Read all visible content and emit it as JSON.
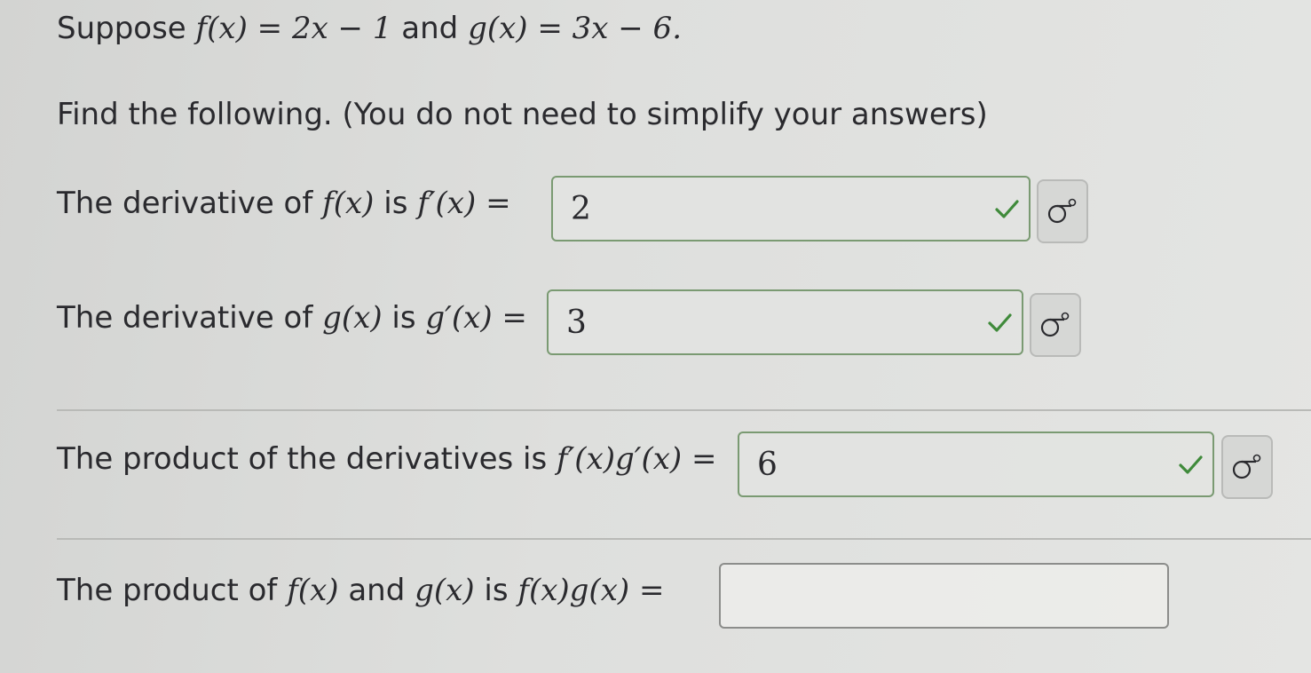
{
  "problem": {
    "intro_text": "Suppose",
    "f_def": "f(x) = 2x − 1",
    "and_text": "and",
    "g_def": "g(x) = 3x − 6.",
    "instructions": "Find the following. (You do not need to simplify your answers)"
  },
  "rows": [
    {
      "label_prefix": "The derivative of",
      "func": "f(x)",
      "is": "is",
      "expr": "f′(x)",
      "equals": "=",
      "answer": "2",
      "status": "correct"
    },
    {
      "label_prefix": "The derivative of",
      "func": "g(x)",
      "is": "is",
      "expr": "g′(x)",
      "equals": "=",
      "answer": "3",
      "status": "correct"
    },
    {
      "label_prefix": "The product of the derivatives is",
      "expr": "f′(x)g′(x)",
      "equals": "=",
      "answer": "6",
      "status": "correct"
    },
    {
      "label_prefix": "The product of",
      "func": "f(x)",
      "and": "and",
      "func2": "g(x)",
      "is": "is",
      "expr": "f(x)g(x)",
      "equals": "=",
      "answer": "",
      "status": "unanswered"
    }
  ],
  "colors": {
    "correct_border": "#7a9a72",
    "check": "#3f8a3a"
  },
  "icons": {
    "symbol_button": "sigma-symbol-icon",
    "check": "check-icon"
  }
}
